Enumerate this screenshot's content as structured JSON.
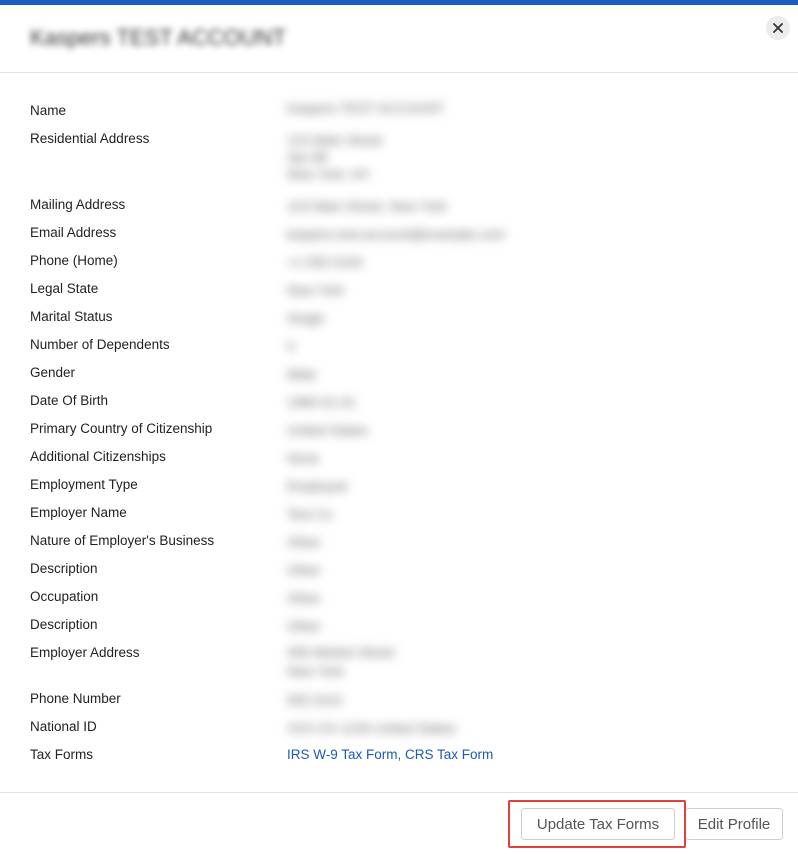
{
  "modal": {
    "title": "Kaspers TEST ACCOUNT",
    "close_glyph": "×"
  },
  "fields": [
    {
      "label": "Name",
      "value": "Kaspers TEST ACCOUNT"
    },
    {
      "label": "Residential Address",
      "value_lines": [
        "123 Main Street",
        "Apt 4B",
        "New York, NY"
      ]
    },
    {
      "label": "Mailing Address",
      "value": "123 Main Street, New York"
    },
    {
      "label": "Email Address",
      "value": "kaspers.test.account@example.com"
    },
    {
      "label": "Phone (Home)",
      "value": "+1 555 0100"
    },
    {
      "label": "Legal State",
      "value": "New York"
    },
    {
      "label": "Marital Status",
      "value": "Single"
    },
    {
      "label": "Number of Dependents",
      "value": "0"
    },
    {
      "label": "Gender",
      "value": "Male"
    },
    {
      "label": "Date Of Birth",
      "value": "1980-01-01"
    },
    {
      "label": "Primary Country of Citizenship",
      "value": "United States"
    },
    {
      "label": "Additional Citizenships",
      "value": "None"
    },
    {
      "label": "Employment Type",
      "value": "Employed"
    },
    {
      "label": "Employer Name",
      "value": "Test Co"
    },
    {
      "label": "Nature of Employer's Business",
      "value": "Other"
    },
    {
      "label": "Description",
      "value": "Other"
    },
    {
      "label": "Occupation",
      "value": "Other"
    },
    {
      "label": "Description",
      "value": "Other"
    },
    {
      "label": "Employer Address",
      "value_lines": [
        "456 Market Street",
        "New York"
      ]
    },
    {
      "label": "Phone Number",
      "value": "555 0101"
    },
    {
      "label": "National ID",
      "value": "XXX-XX-1234 United States"
    },
    {
      "label": "Tax Forms",
      "value": "IRS W-9 Tax Form, CRS Tax Form"
    }
  ],
  "footer": {
    "update_tax_forms_label": "Update Tax Forms",
    "edit_profile_label": "Edit Profile"
  },
  "colors": {
    "accent_bar": "#1a5bc4",
    "link": "#1c5ab8",
    "highlight": "#e0413e"
  }
}
